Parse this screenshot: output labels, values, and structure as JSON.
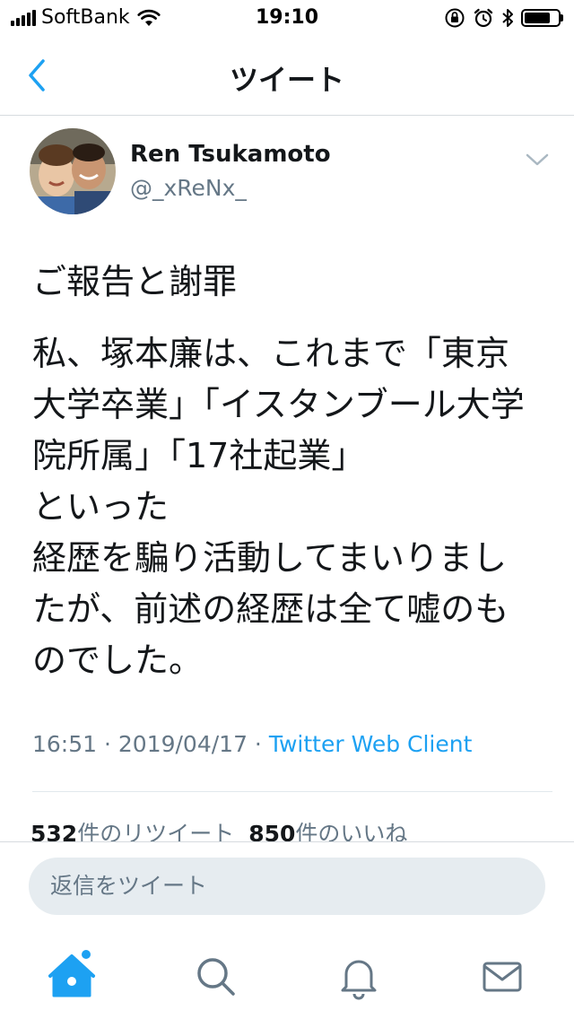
{
  "status_bar": {
    "carrier": "SoftBank",
    "time": "19:10",
    "icons": [
      "signal-bars-icon",
      "wifi-icon",
      "orientation-lock-icon",
      "alarm-icon",
      "bluetooth-icon",
      "battery-icon"
    ],
    "battery_level": 0.8
  },
  "nav": {
    "title": "ツイート",
    "back_icon": "chevron-left-icon"
  },
  "tweet": {
    "author": {
      "display_name": "Ren Tsukamoto",
      "handle": "@_xReNx_"
    },
    "title": "ご報告と謝罪",
    "body": "私、塚本廉は、これまで「東京大学卒業」「イスタンブール大学院所属」「17社起業」\nといった\n経歴を騙り活動してまいりましたが、前述の経歴は全て嘘のものでした。",
    "time": "16:51",
    "separator": " · ",
    "date": "2019/04/17",
    "client": "Twitter Web Client"
  },
  "stats": {
    "retweet_count": "532",
    "retweet_label": "件のリツイート",
    "like_count": "850",
    "like_label": "件のいいね"
  },
  "reply": {
    "placeholder": "返信をツイート"
  },
  "tabs": [
    {
      "name": "home",
      "icon": "home-icon",
      "has_notification_dot": true
    },
    {
      "name": "search",
      "icon": "search-icon"
    },
    {
      "name": "notifications",
      "icon": "bell-icon"
    },
    {
      "name": "messages",
      "icon": "mail-icon"
    }
  ],
  "colors": {
    "accent": "#1da1f2",
    "text": "#14171a",
    "secondary_text": "#657786",
    "divider": "#e1e8ed",
    "reply_bg": "#e6ecf0"
  }
}
